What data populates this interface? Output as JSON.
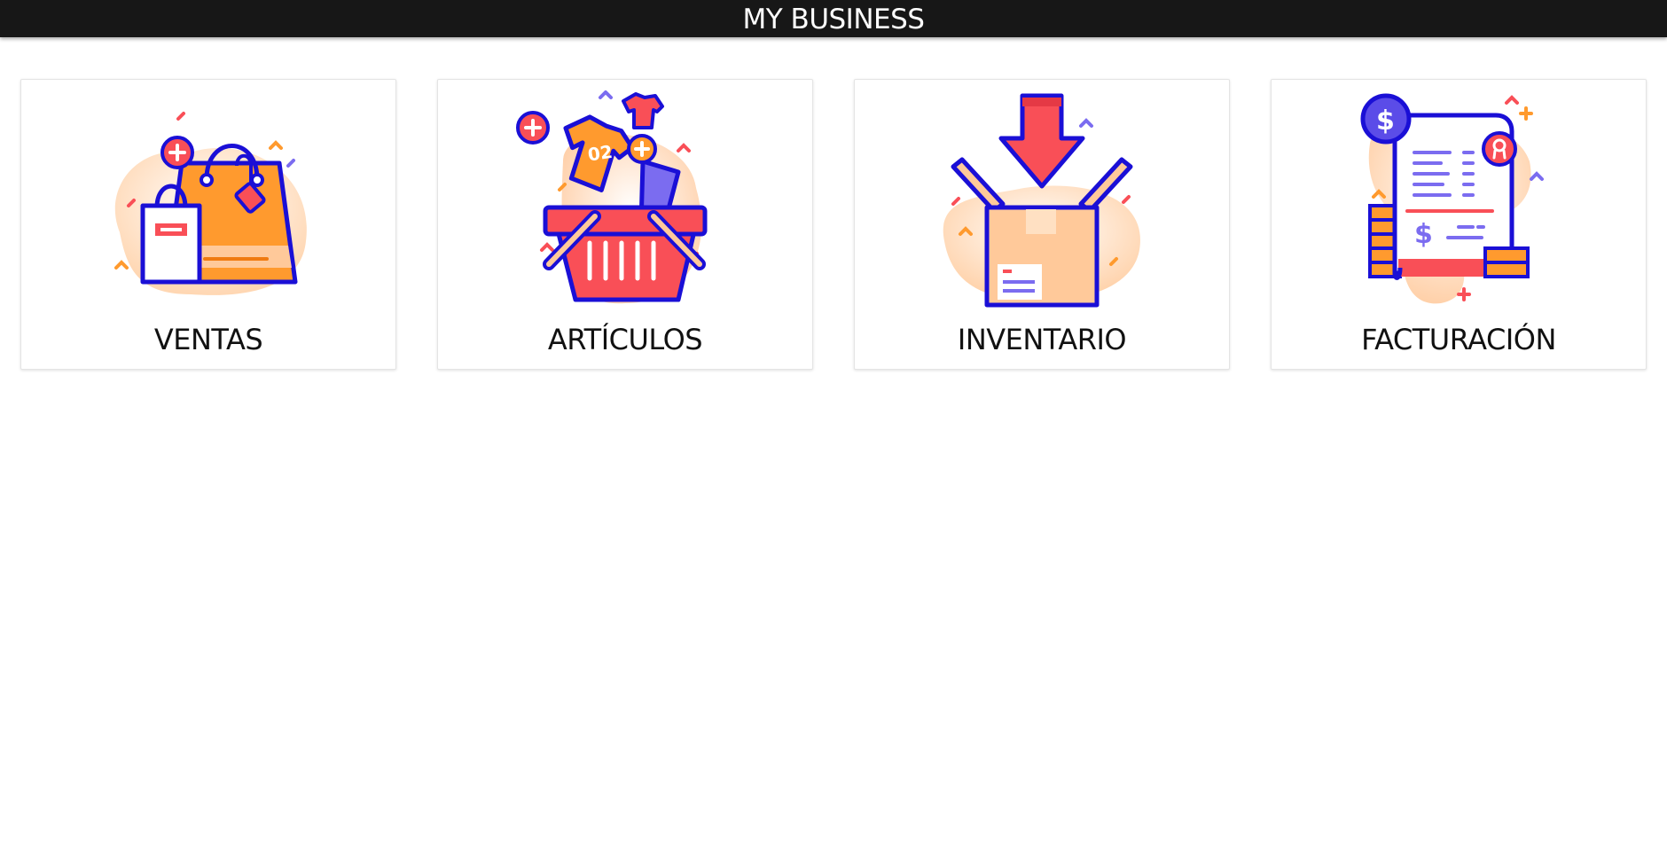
{
  "header": {
    "title": "MY BUSINESS"
  },
  "cards": [
    {
      "label": "VENTAS",
      "icon": "shopping-bags-icon"
    },
    {
      "label": "ARTÍCULOS",
      "icon": "basket-clothes-icon"
    },
    {
      "label": "INVENTARIO",
      "icon": "box-download-icon"
    },
    {
      "label": "FACTURACIÓN",
      "icon": "invoice-coins-icon"
    }
  ],
  "colors": {
    "header_bg": "#171717",
    "outline": "#1a0fd6",
    "orange": "#ff9a2e",
    "red": "#f94f57",
    "peach": "#ffc99a",
    "purple": "#7b6cf0"
  }
}
